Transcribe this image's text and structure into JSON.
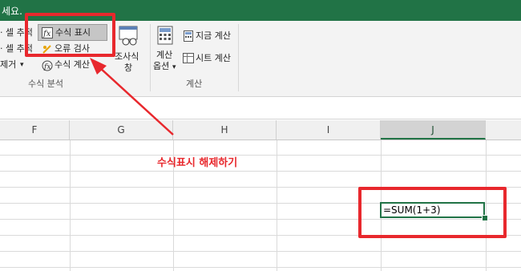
{
  "titlebar": {
    "text": "세요."
  },
  "ribbon": {
    "formula_auditing": {
      "trace_precedents": "· 셀 추적",
      "trace_dependents": "· 셀 추적",
      "remove_arrows": "제거",
      "remove_arrows_dropdown": "▾",
      "show_formulas": "수식 표시",
      "error_checking": "오류 검사",
      "evaluate_formula": "수식 계산",
      "group_label": "수식 분석"
    },
    "watch_window": {
      "line1": "조사식",
      "line2": "창"
    },
    "calculation": {
      "options_line1": "계산",
      "options_line2": "옵션",
      "options_dropdown": "▾",
      "calc_now": "지금 계산",
      "calc_sheet": "시트 계산",
      "group_label": "계산"
    }
  },
  "columns": [
    "F",
    "G",
    "H",
    "I",
    "J"
  ],
  "selected_column": "J",
  "active_cell": {
    "value": "=SUM(1+3)"
  },
  "annotation": {
    "text": "수식표시 해제하기",
    "color": "#e8282d"
  },
  "colors": {
    "excel_green": "#217346",
    "annotation_red": "#e8282d"
  }
}
